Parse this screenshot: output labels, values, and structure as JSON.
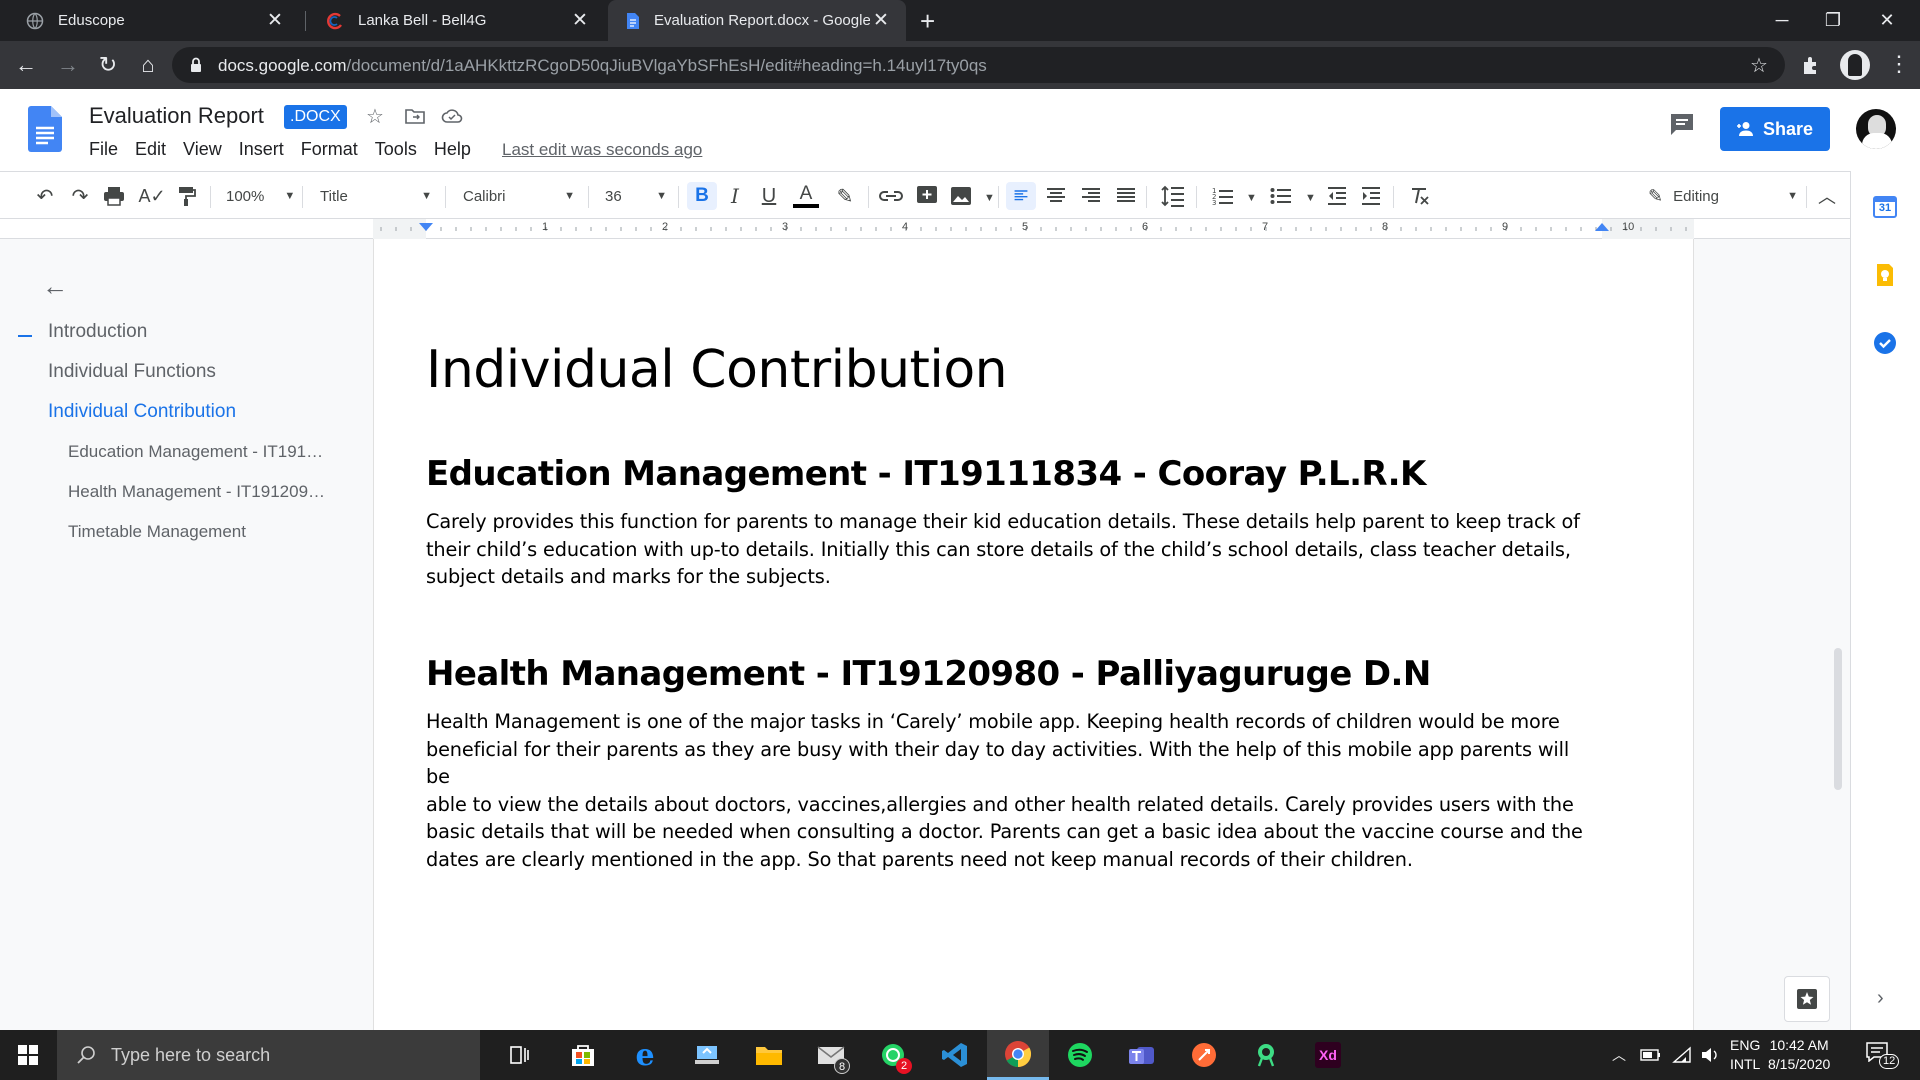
{
  "browser": {
    "tabs": [
      {
        "label": "Eduscope",
        "active": false
      },
      {
        "label": "Lanka Bell - Bell4G",
        "active": false
      },
      {
        "label": "Evaluation Report.docx - Google",
        "active": true
      }
    ],
    "url_host": "docs.google.com",
    "url_path": "/document/d/1aAHKkttzRCgoD50qJiuBVlgaYbSFhEsH/edit#heading=h.14uyl17ty0qs"
  },
  "docs": {
    "title": "Evaluation Report",
    "badge": ".DOCX",
    "menu": [
      "File",
      "Edit",
      "View",
      "Insert",
      "Format",
      "Tools",
      "Help"
    ],
    "last_edit": "Last edit was seconds ago",
    "share_label": "Share"
  },
  "format_toolbar": {
    "zoom": "100%",
    "style": "Title",
    "font": "Calibri",
    "font_size": "36",
    "mode": "Editing",
    "bold_active": true,
    "align_left_active": true
  },
  "ruler": {
    "numbers": [
      "1",
      "2",
      "3",
      "4",
      "5",
      "6",
      "7",
      "8",
      "9",
      "10"
    ]
  },
  "outline": {
    "items": [
      {
        "label": "Introduction",
        "level": 1,
        "active": false
      },
      {
        "label": "Individual Functions",
        "level": 1,
        "active": false
      },
      {
        "label": "Individual Contribution",
        "level": 1,
        "active": true
      },
      {
        "label": "Education Management - IT191…",
        "level": 2,
        "active": false
      },
      {
        "label": "Health Management - IT191209…",
        "level": 2,
        "active": false
      },
      {
        "label": "Timetable Management",
        "level": 2,
        "active": false
      }
    ]
  },
  "document": {
    "title": "Individual Contribution",
    "sections": [
      {
        "heading": "Education Management - IT19111834 - Cooray P.L.R.K",
        "lines": [
          "Carely provides this function for parents to manage their kid education details. These details help parent to keep track of",
          "their child’s education with up-to details. Initially this can store details of the child’s school details, class teacher details,",
          "subject details and marks for the subjects."
        ]
      },
      {
        "heading": "Health Management - IT19120980 - Palliyaguruge D.N",
        "lines": [
          "Health Management is one of the major tasks in ‘Carely’ mobile app. Keeping health records of children would be more",
          "beneficial for their parents as they are busy with their day to day activities. With the help of this mobile app parents will be",
          "able to view the details about doctors, vaccines,allergies and other health related details. Carely provides users with the",
          "basic details that will be needed when consulting a doctor. Parents can get a basic idea about the vaccine course and the",
          "dates are clearly mentioned in the app. So that parents need not keep manual records of their children."
        ]
      }
    ]
  },
  "side_panel": {
    "calendar_day": "31"
  },
  "taskbar": {
    "search_placeholder": "Type here to search",
    "mail_badge": "8",
    "whatsapp_badge": "2",
    "lang_top": "ENG",
    "lang_bottom": "INTL",
    "time": "10:42 AM",
    "date": "8/15/2020",
    "notification_count": "12"
  },
  "colors": {
    "accent": "#1a73e8",
    "chrome_dark": "#202124",
    "taskbar": "#1f1f1f"
  }
}
